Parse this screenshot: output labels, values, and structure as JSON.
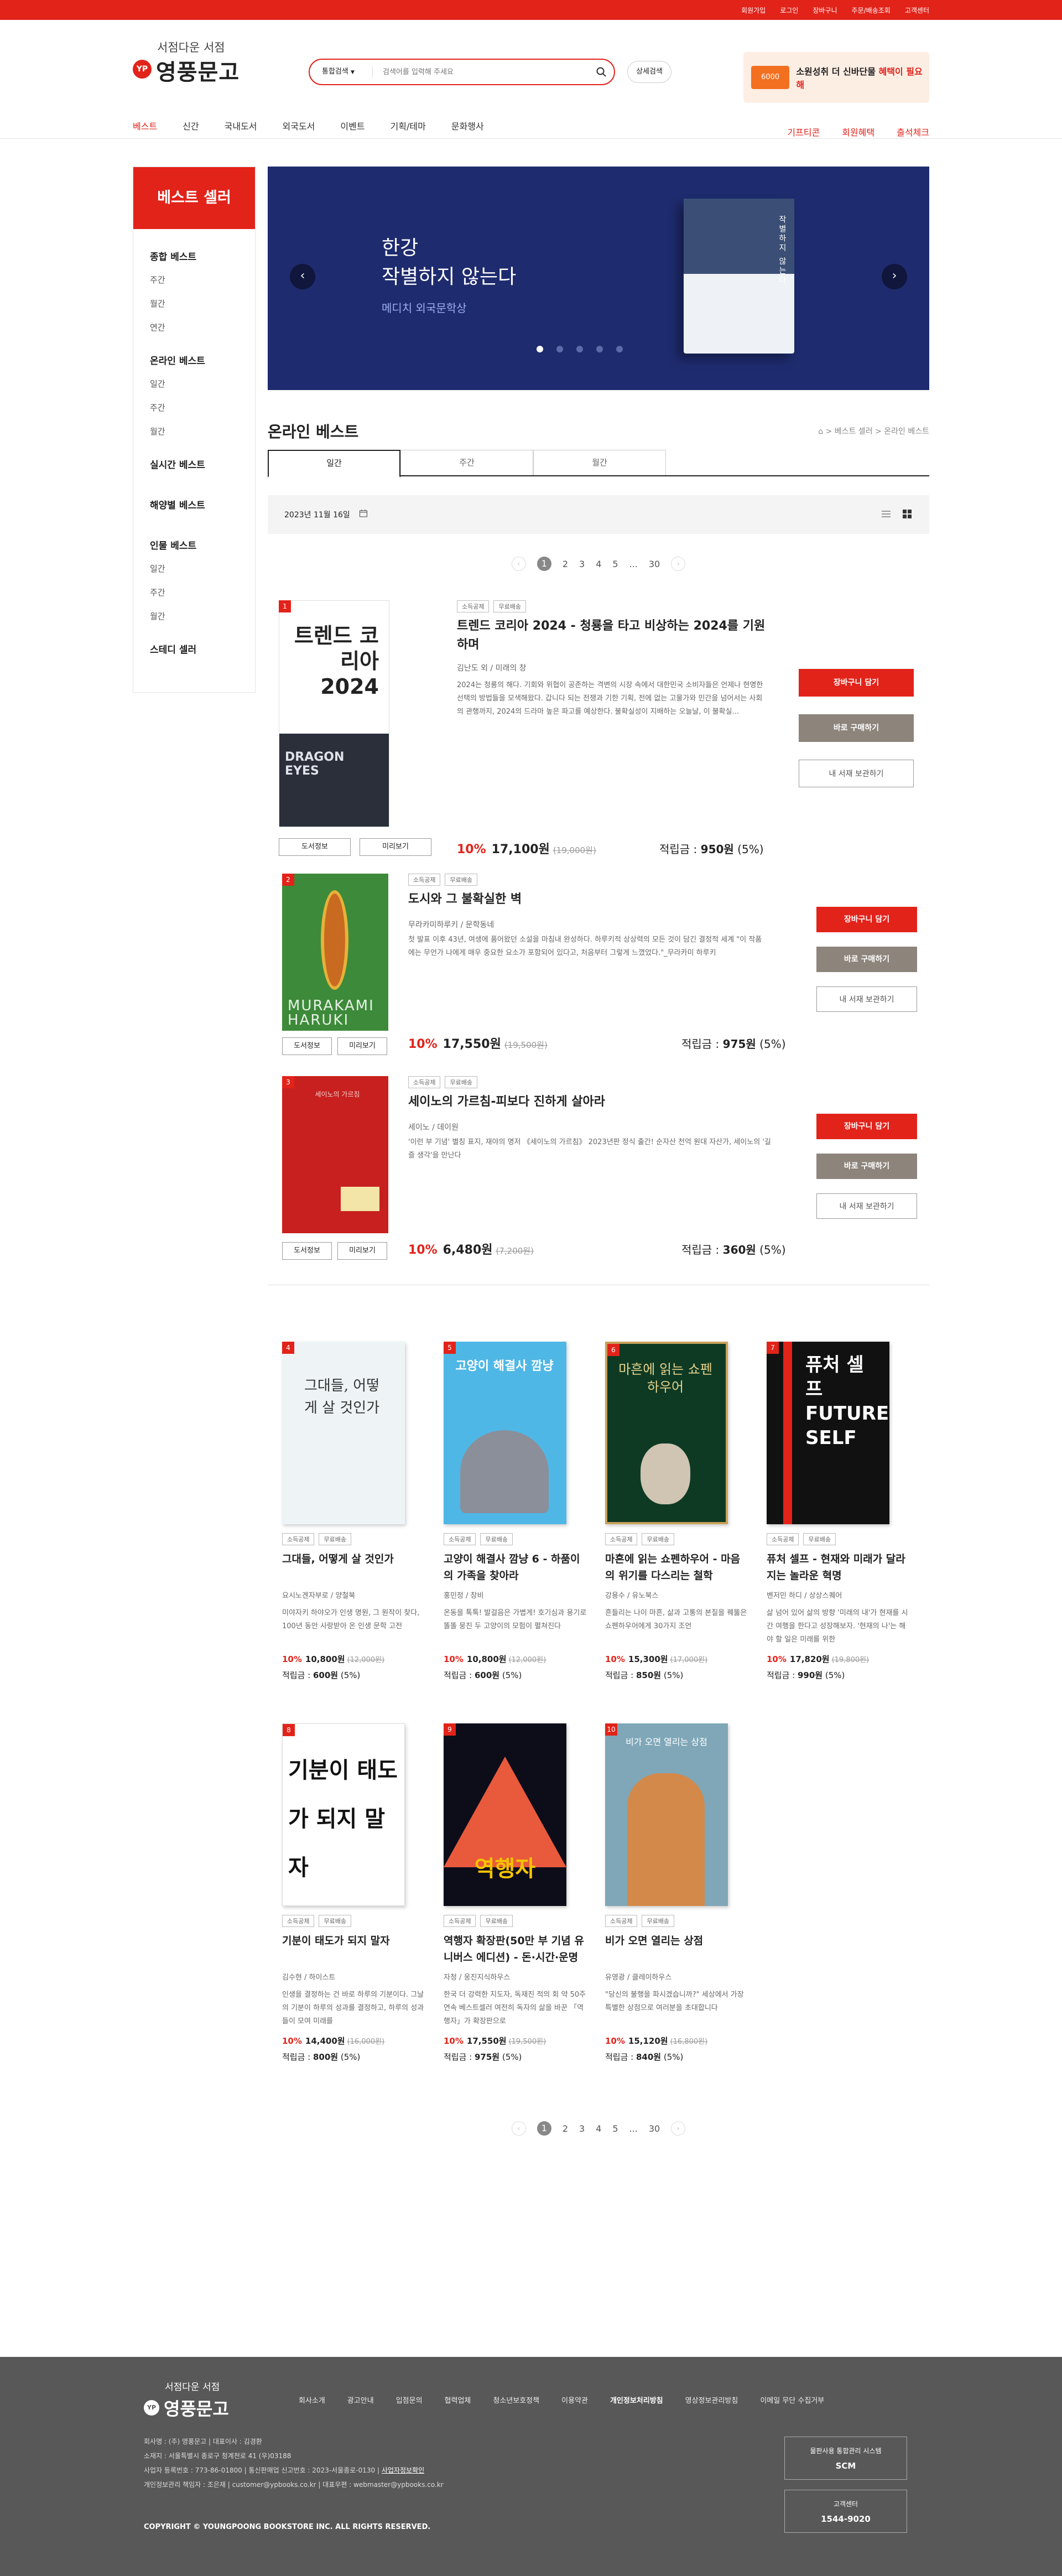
{
  "topbar": {
    "links": [
      "회원가입",
      "로그인",
      "장바구니",
      "주문/배송조회",
      "고객센터"
    ]
  },
  "logo": {
    "sub": "서점다운 서점",
    "main": "영풍문고",
    "mark": "YP"
  },
  "search": {
    "category": "통합검색",
    "placeholder": "검색어를 입력해 주세요",
    "detail": "상세검색"
  },
  "promo": {
    "badge": "6000",
    "text": "소원성취 더 신바단물",
    "highlight": "혜택이 필요해"
  },
  "gnb": {
    "left": [
      "베스트",
      "신간",
      "국내도서",
      "외국도서",
      "이벤트",
      "기획/테마",
      "문화행사"
    ],
    "right": [
      "기프티콘",
      "회원혜택",
      "출석체크"
    ]
  },
  "lnb": {
    "title": "베스트 셀러",
    "groups": [
      {
        "title": "종합 베스트",
        "items": [
          "주간",
          "월간",
          "연간"
        ]
      },
      {
        "title": "온라인 베스트",
        "items": [
          "일간",
          "주간",
          "월간"
        ]
      },
      {
        "title": "실시간 베스트",
        "items": []
      },
      {
        "title": "해양별 베스트",
        "items": []
      },
      {
        "title": "인물 베스트",
        "items": [
          "일간",
          "주간",
          "월간"
        ]
      },
      {
        "title": "스테디 셀러",
        "items": []
      }
    ]
  },
  "banner": {
    "title_line1": "한강",
    "title_line2": "작별하지 않는다",
    "subtitle": "메디치 외국문학상",
    "book_title": "작별하지 않는다",
    "prev": "‹",
    "next": "›",
    "dots": 5
  },
  "section": {
    "title": "온라인 베스트",
    "breadcrumb": [
      "베스트 셀러",
      "온라인 베스트"
    ]
  },
  "tabs": [
    "일간",
    "주간",
    "월간"
  ],
  "datebar": {
    "date": "2023년 11월 16일"
  },
  "pager": {
    "pages": [
      "1",
      "2",
      "3",
      "4",
      "5",
      "...",
      "30"
    ],
    "current": "1"
  },
  "list_buttons": {
    "info": "도서정보",
    "preview": "미리보기",
    "cart": "장바구니 담기",
    "buy": "바로 구매하기",
    "wish": "내 서재 보관하기"
  },
  "tags": [
    "소득공제",
    "무료배송"
  ],
  "point_label": "적립금 : ",
  "list_books": [
    {
      "rank": "1",
      "title": "트렌드 코리아 2024 - 청룡을 타고 비상하는 2024를 기원하며",
      "author": "김난도 외 / 미래의 창",
      "desc": "2024는 청룡의 해다. 기회와 위협이 공존하는 격변의 시장 속에서 대한민국 소비자들은 언제나 현명한 선택의 방법들을 모색해왔다. 갑니다 되는 전쟁과 기한 기획, 전에 없는 고물가와 민간을 넘어서는 사회의 관행까지, 2024의 드라마 높은 파고를 예상한다. 불확실성이 지배하는 오늘날, 이 불확실...",
      "pct": "10%",
      "price": "17,100원",
      "orig": "(19,000원)",
      "point": "950원",
      "rate": "(5%)",
      "cover_top": "트렌드 코리아 2024",
      "cover_bottom": "DRAGON EYES"
    },
    {
      "rank": "2",
      "title": "도시와 그 불확실한 벽",
      "author": "무라카미하루키 / 문학동네",
      "desc": "첫 발표 이후 43년, 여생에 품어왔던 소설을 마침내 완성하다. 하루키적 상상력의 모든 것이 담긴 결정적 세계 \"이 작품에는 무언가 나에게 매우 중요한 요소가 포함되어 있다고, 처음부터 그렇게 느꼈었다.\"_무라카미 하루키",
      "pct": "10%",
      "price": "17,550원",
      "orig": "(19,500원)",
      "point": "975원",
      "rate": "(5%)",
      "cover_top": "MURAKAMI HARUKI",
      "cover_bottom": ""
    },
    {
      "rank": "3",
      "title": "세이노의 가르침-피보다 진하게 살아라",
      "author": "세이노 / 데이원",
      "desc": "'이런 부 기념' 별칭 표지, 재야의 명저 《세이노의 가르침》 2023년판 정식 출간! 순자산 천억 원대 자산가, 세이노의 '길즐 생각'을 만난다",
      "pct": "10%",
      "price": "6,480원",
      "orig": "(7,200원)",
      "point": "360원",
      "rate": "(5%)",
      "cover_top": "세이노의 가르침",
      "cover_bottom": ""
    }
  ],
  "grid_books": [
    {
      "rank": "4",
      "title": "그대들, 어떻게 살 것인가",
      "author": "요시노겐자부로 / 양철북",
      "desc": "미야자키 하야오가 인생 명원, 그 원작이 찾다, 100년 동안 사랑받아 온 인생 문학 고전",
      "pct": "10%",
      "price": "10,800원",
      "orig": "(12,000원)",
      "point": "600원",
      "rate": "(5%)",
      "cover": "그대들, 어떻게 살 것인가"
    },
    {
      "rank": "5",
      "title": "고양이 해결사 깜냥 6 - 하품이의 가족을 찾아라",
      "author": "홍민정 / 창비",
      "desc": "온동을 톡톡! 발걸음은 가볍게! 호기심과 용기로 똘똘 뭉친 두 고양이의 모험이 펼쳐진다",
      "pct": "10%",
      "price": "10,800원",
      "orig": "(12,000원)",
      "point": "600원",
      "rate": "(5%)",
      "cover": "고양이 해결사 깜냥"
    },
    {
      "rank": "6",
      "title": "마흔에 읽는 쇼펜하우어 - 마음의 위기를 다스리는 철학",
      "author": "강용수 / 유노북스",
      "desc": "흔들리는 나이 마흔, 삶과 고통의 본질을 꿰뚫은 쇼펜하우어에게 30가지 조언",
      "pct": "10%",
      "price": "15,300원",
      "orig": "(17,000원)",
      "point": "850원",
      "rate": "(5%)",
      "cover": "마흔에 읽는 쇼펜하우어"
    },
    {
      "rank": "7",
      "title": "퓨처 셀프 - 현재와 미래가 달라지는 놀라운 혁명",
      "author": "벤저민 하디 / 상상스퀘어",
      "desc": "삶 넘어 있어 삶의 방향 '미래의 내'가 현재를 시간 여행을 한다고 성장해보자. '현재의 나'는 해야 할 일은 미래를 위한",
      "pct": "10%",
      "price": "17,820원",
      "orig": "(19,800원)",
      "point": "990원",
      "rate": "(5%)",
      "cover": "퓨처 셀프 FUTURE SELF"
    },
    {
      "rank": "8",
      "title": "기분이 태도가 되지 말자",
      "author": "김수현 / 하이스트",
      "desc": "인생을 결정하는 건 바로 하루의 기분이다. 그날의 기분이 하루의 성과를 결정하고, 하루의 성과들이 모여 미래를",
      "pct": "10%",
      "price": "14,400원",
      "orig": "(16,000원)",
      "point": "800원",
      "rate": "(5%)",
      "cover": "기분이 태도가 되지 말자"
    },
    {
      "rank": "9",
      "title": "역행자 확장판(50만 부 기념 유니버스 에디션) - 돈·시간·운명으로부터",
      "author": "자청 / 웅진지식하우스",
      "desc": "한국 더 강력한 지도자, 독재진 적의 회 약 50주 연속 베스트셀러 여전히 독자의 삶을 바꾼 「역행자」가 확장판으로",
      "pct": "10%",
      "price": "17,550원",
      "orig": "(19,500원)",
      "point": "975원",
      "rate": "(5%)",
      "cover": "역행자"
    },
    {
      "rank": "10",
      "title": "비가 오면 열리는 상점",
      "author": "유영광 / 클레이하우스",
      "desc": "\"당신의 불행을 파시겠습니까?\" 세상에서 가장 특별한 상점으로 여러분을 초대합니다",
      "pct": "10%",
      "price": "15,120원",
      "orig": "(16,800원)",
      "point": "840원",
      "rate": "(5%)",
      "cover": "비가 오면 열리는 상점"
    }
  ],
  "footer": {
    "logo_sub": "서점다운 서점",
    "logo_main": "영풍문고",
    "menu": [
      "회사소개",
      "광고안내",
      "입점문의",
      "협력업체",
      "청소년보호정책",
      "이용약관",
      "개인정보처리방침",
      "영상정보관리방침",
      "이메일 무단 수집거부"
    ],
    "info": [
      "회사명 : (주) 영풍문고 | 대표이사 : 김경환",
      "소재지 : 서울특별시 종로구 청계천로 41 (우)03188",
      "사업자 등록번호 : 773-86-01800 | 통신판매업 신고번호 : 2023-서울종로-0130 |",
      "개인정보관리 책임자 : 조은재 | customer@ypbooks.co.kr | 대표우편 : webmaster@ypbooks.co.kr"
    ],
    "license_link": "사업자정보확인",
    "copyright": "COPYRIGHT © YOUNGPOONG BOOKSTORE INC. ALL RIGHTS RESERVED.",
    "box1_title": "물판사용 통합관리 시스템",
    "box1_value": "SCM",
    "box2_title": "고객센터",
    "box2_value": "1544-9020"
  },
  "colors": {
    "brand": "#e2231a",
    "buy": "#8d847c",
    "footer": "#585858"
  }
}
